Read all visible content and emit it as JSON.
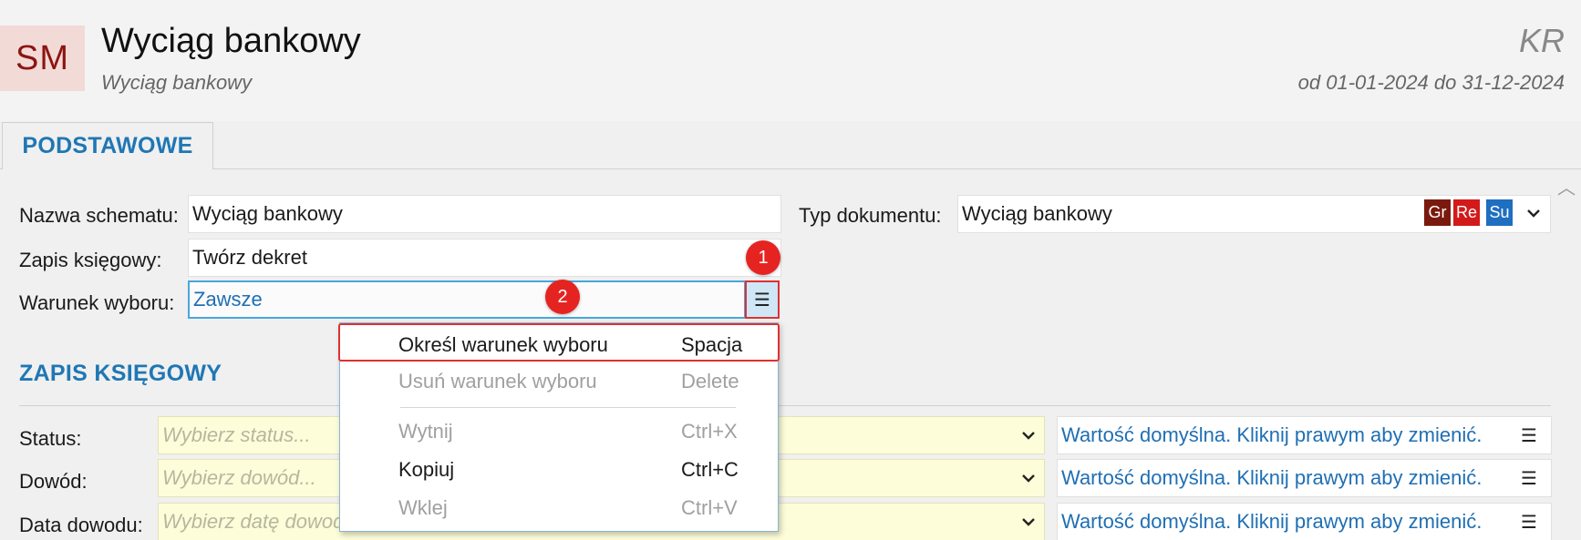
{
  "header": {
    "logo": "SM",
    "title": "Wyciąg bankowy",
    "subtitle": "Wyciąg bankowy",
    "company": "KR",
    "period": "od 01-01-2024 do 31-12-2024"
  },
  "tabs": [
    {
      "label": "PODSTAWOWE"
    }
  ],
  "form": {
    "schema_name": {
      "label": "Nazwa schematu:",
      "value": "Wyciąg bankowy"
    },
    "doc_type": {
      "label": "Typ dokumentu:",
      "value": "Wyciąg bankowy",
      "badges": [
        "Gr",
        "Re",
        "Su"
      ]
    },
    "accounting_entry": {
      "label": "Zapis księgowy:",
      "value": "Twórz dekret"
    },
    "selection_condition": {
      "label": "Warunek wyboru:",
      "value": "Zawsze"
    }
  },
  "callouts": [
    "1",
    "2"
  ],
  "section": {
    "title": "ZAPIS KSIĘGOWY",
    "rows": [
      {
        "label": "Status:",
        "placeholder": "Wybierz status...",
        "default": "Wartość domyślna. Kliknij prawym aby zmienić."
      },
      {
        "label": "Dowód:",
        "placeholder": "Wybierz dowód...",
        "default": "Wartość domyślna. Kliknij prawym aby zmienić."
      },
      {
        "label": "Data dowodu:",
        "placeholder": "Wybierz datę dowodu...",
        "default": "Wartość domyślna. Kliknij prawym aby zmienić."
      }
    ]
  },
  "context_menu": {
    "items": [
      {
        "label": "Określ warunek wyboru",
        "shortcut": "Spacja",
        "enabled": true
      },
      {
        "label": "Usuń warunek wyboru",
        "shortcut": "Delete",
        "enabled": false
      },
      {
        "label": "Wytnij",
        "shortcut": "Ctrl+X",
        "enabled": false
      },
      {
        "label": "Kopiuj",
        "shortcut": "Ctrl+C",
        "enabled": true
      },
      {
        "label": "Wklej",
        "shortcut": "Ctrl+V",
        "enabled": false
      }
    ]
  },
  "colors": {
    "accent": "#1f77b4",
    "logo_bg": "#f2dad7",
    "logo_fg": "#8b1512",
    "badge_gr": "#7a1a0e",
    "badge_re": "#d21a1a",
    "badge_su": "#1e6fc0",
    "callout": "#e52421",
    "required_bg": "#fdfdd9"
  },
  "icons": {
    "menu": "hamburger-icon",
    "dropdown": "chevron-down-icon",
    "scroll": "chevron-up-icon"
  }
}
